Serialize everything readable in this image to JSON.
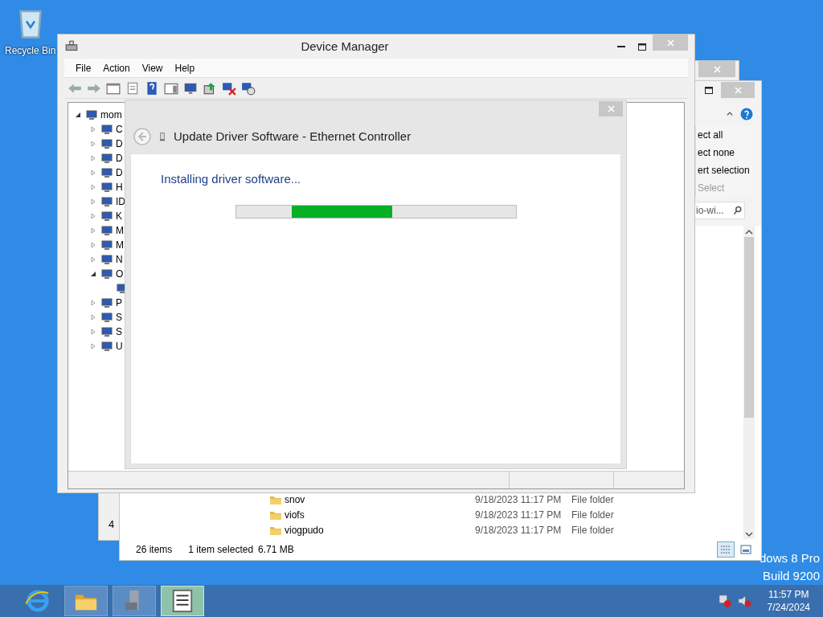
{
  "desktop": {
    "icons": [
      {
        "label": "Recycle Bin"
      }
    ],
    "edition_lines": [
      "dows 8 Pro",
      "Build 9200"
    ]
  },
  "device_manager": {
    "title": "Device Manager",
    "menu": [
      "File",
      "Action",
      "View",
      "Help"
    ],
    "tree": {
      "label": "mom",
      "expanded": true,
      "children": [
        {
          "label": "C",
          "expanded": false
        },
        {
          "label": "D",
          "expanded": false
        },
        {
          "label": "D",
          "expanded": false
        },
        {
          "label": "D",
          "expanded": false
        },
        {
          "label": "H",
          "expanded": false
        },
        {
          "label": "ID",
          "expanded": false
        },
        {
          "label": "K",
          "expanded": false
        },
        {
          "label": "M",
          "expanded": false
        },
        {
          "label": "M",
          "expanded": false
        },
        {
          "label": "N",
          "expanded": false
        },
        {
          "label": "O",
          "expanded": true,
          "children": [
            {
              "kind": "device"
            }
          ]
        },
        {
          "label": "P",
          "expanded": false
        },
        {
          "label": "S",
          "expanded": false
        },
        {
          "label": "S",
          "expanded": false
        },
        {
          "label": "U",
          "expanded": false
        }
      ]
    }
  },
  "update_dialog": {
    "title": "Update Driver Software - Ethernet Controller",
    "status": "Installing driver software...",
    "progress": {
      "level": 0.36
    }
  },
  "middle_window": {
    "text": "4"
  },
  "explorer": {
    "ribbon": [
      {
        "label": "ect all",
        "kind": "command"
      },
      {
        "label": "ect none",
        "kind": "command"
      },
      {
        "label": "ert selection",
        "kind": "command"
      },
      {
        "label": "Select",
        "kind": "group_label"
      }
    ],
    "search": {
      "value": "io-wi..."
    },
    "files": [
      {
        "name": "snov",
        "date": "9/18/2023 11:17 PM",
        "type": "File folder"
      },
      {
        "name": "viofs",
        "date": "9/18/2023 11:17 PM",
        "type": "File folder"
      },
      {
        "name": "viogpudo",
        "date": "9/18/2023 11:17 PM",
        "type": "File folder"
      }
    ],
    "status": [
      "26 items",
      "1 item selected",
      "6.71 MB"
    ]
  },
  "taskbar": {
    "apps": [
      {
        "kind": "browser",
        "selected": false
      },
      {
        "kind": "folder",
        "selected": false
      },
      {
        "kind": "server",
        "selected": false
      },
      {
        "kind": "devices",
        "selected": true
      }
    ],
    "clock": {
      "time": "11:57 PM",
      "date": "7/24/2024"
    }
  }
}
